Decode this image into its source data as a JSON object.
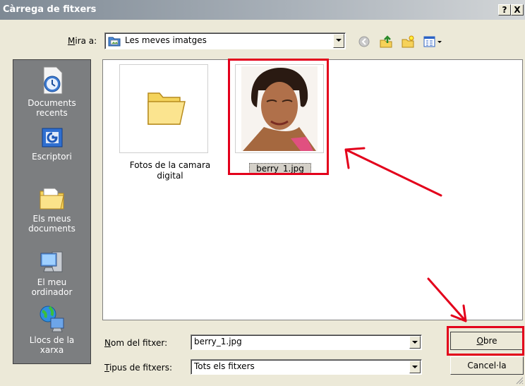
{
  "window": {
    "title": "Càrrega de fitxers",
    "help_button": "?",
    "close_button": "X"
  },
  "toolbar": {
    "look_in_label_u": "M",
    "look_in_label_rest": "ira a:",
    "look_in_value": "Les meves imatges"
  },
  "places": {
    "recent": [
      "Documents",
      "recents"
    ],
    "desktop": [
      "Escriptori"
    ],
    "documents": [
      "Els meus",
      "documents"
    ],
    "computer": [
      "El meu",
      "ordinador"
    ],
    "network": [
      "Llocs de la",
      "xarxa"
    ]
  },
  "files": {
    "folder_label": [
      "Fotos de la camara",
      "digital"
    ],
    "image_label": "berry_1.jpg"
  },
  "bottom": {
    "filename_label_u": "N",
    "filename_label_rest": "om del fitxer:",
    "filename_value": "berry_1.jpg",
    "filetype_label_u": "T",
    "filetype_label_rest": "ipus de fitxers:",
    "filetype_value": "Tots els fitxers",
    "open_button_u": "O",
    "open_button_rest": "bre",
    "cancel_button": "Cancel·la"
  },
  "annotation_color": "#e3001b"
}
